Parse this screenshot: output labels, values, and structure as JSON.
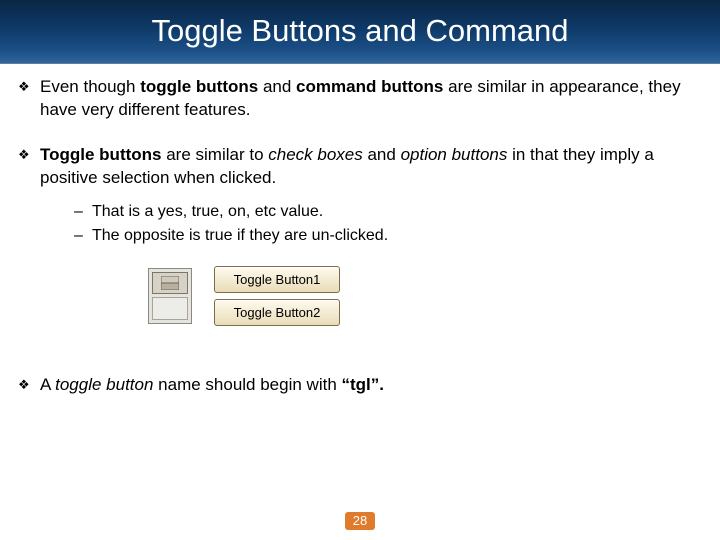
{
  "title": "Toggle Buttons and Command",
  "bullets": {
    "b1": {
      "pre": "Even though ",
      "bold1": "toggle buttons",
      "mid1": " and ",
      "bold2": "command buttons",
      "post": " are similar in appearance, they have very different features."
    },
    "b2": {
      "bold1": "Toggle buttons",
      "mid1": " are similar to ",
      "ital1": "check boxes",
      "mid2": " and ",
      "ital2": "option buttons",
      "post": " in that they imply a positive selection when clicked."
    },
    "sub1": "That is a yes, true, on, etc value.",
    "sub2": "The opposite is true if they are un-clicked.",
    "b3": {
      "pre": "A ",
      "ital1": "toggle button",
      "mid1": " name should begin with ",
      "bold1": "“tgl”.",
      "post": ""
    }
  },
  "graphic": {
    "btn1": "Toggle Button1",
    "btn2": "Toggle Button2"
  },
  "page_number": "28"
}
